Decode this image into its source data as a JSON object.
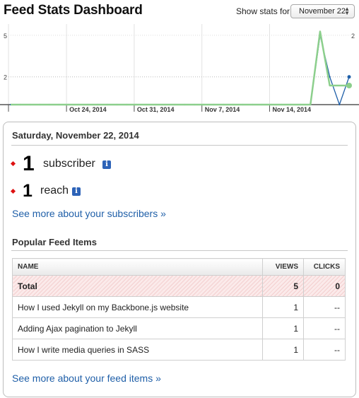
{
  "header": {
    "title": "Feed Stats Dashboard",
    "stats_label": "Show stats for",
    "selected_date": "November 22"
  },
  "chart_data": {
    "type": "line",
    "y_left_ticks": [
      "5",
      "2"
    ],
    "y_right_ticks": [
      "2"
    ],
    "x_tick_labels": [
      "Oct 24, 2014",
      "Oct 31, 2014",
      "Nov 7, 2014",
      "Nov 14, 2014"
    ],
    "x": [
      "Oct 18",
      "Oct 19",
      "Oct 20",
      "Oct 21",
      "Oct 22",
      "Oct 23",
      "Oct 24",
      "Oct 25",
      "Oct 26",
      "Oct 27",
      "Oct 28",
      "Oct 29",
      "Oct 30",
      "Oct 31",
      "Nov 1",
      "Nov 2",
      "Nov 3",
      "Nov 4",
      "Nov 5",
      "Nov 6",
      "Nov 7",
      "Nov 8",
      "Nov 9",
      "Nov 10",
      "Nov 11",
      "Nov 12",
      "Nov 13",
      "Nov 14",
      "Nov 15",
      "Nov 16",
      "Nov 17",
      "Nov 18",
      "Nov 19",
      "Nov 20",
      "Nov 21",
      "Nov 22"
    ],
    "series": [
      {
        "axis": "left",
        "color": "#1f5fa8",
        "values": [
          0,
          0,
          0,
          0,
          0,
          0,
          0,
          0,
          0,
          0,
          0,
          0,
          0,
          0,
          0,
          0,
          0,
          0,
          0,
          0,
          0,
          0,
          0,
          0,
          0,
          0,
          0,
          0,
          0,
          0,
          0,
          0,
          5,
          2,
          0,
          2
        ]
      },
      {
        "axis": "right",
        "color": "#8ccf8c",
        "values": [
          0,
          0,
          0,
          0,
          0,
          0,
          0,
          0,
          0,
          0,
          0,
          0,
          0,
          0,
          0,
          0,
          0,
          0,
          0,
          0,
          0,
          0,
          0,
          0,
          0,
          0,
          0,
          0,
          0,
          0,
          0,
          0,
          2.3,
          0.6,
          0.6,
          0.6
        ]
      }
    ],
    "y_left_max": 5.5,
    "y_right_max": 2.4,
    "grid": true
  },
  "summary": {
    "date_heading": "Saturday, November 22, 2014",
    "subscribers": {
      "value": "1",
      "label": "subscriber"
    },
    "reach": {
      "value": "1",
      "label": "reach"
    },
    "subscribers_link": "See more about your subscribers »"
  },
  "popular": {
    "title": "Popular Feed Items",
    "columns": [
      "NAME",
      "VIEWS",
      "CLICKS"
    ],
    "total": {
      "name": "Total",
      "views": "5",
      "clicks": "0"
    },
    "rows": [
      {
        "name": "How I used Jekyll on my Backbone.js website",
        "views": "1",
        "clicks": "--"
      },
      {
        "name": "Adding Ajax pagination to Jekyll",
        "views": "1",
        "clicks": "--"
      },
      {
        "name": "How I write media queries in SASS",
        "views": "1",
        "clicks": "--"
      }
    ],
    "items_link": "See more about your feed items »"
  },
  "colors": {
    "link": "#1f5fa8",
    "bullet": "#dd1111",
    "info_icon": "#2d63b8",
    "series_primary": "#1f5fa8",
    "series_secondary": "#8ccf8c"
  }
}
